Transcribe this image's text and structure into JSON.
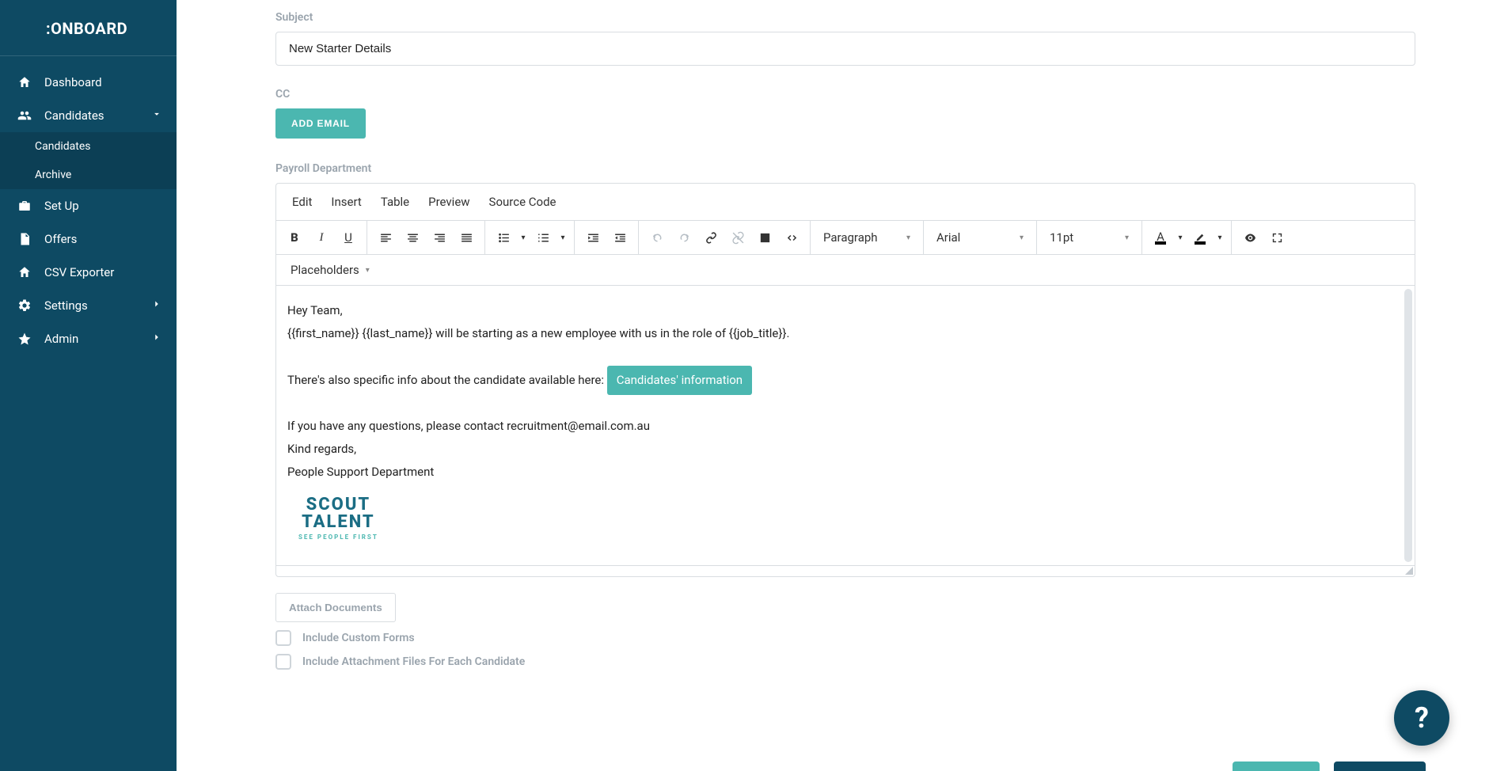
{
  "brand": ":ONBOARD",
  "sidebar": {
    "items": [
      {
        "label": "Dashboard"
      },
      {
        "label": "Candidates"
      },
      {
        "label": "Set Up"
      },
      {
        "label": "Offers"
      },
      {
        "label": "CSV Exporter"
      },
      {
        "label": "Settings"
      },
      {
        "label": "Admin"
      }
    ],
    "candidates_sub": [
      {
        "label": "Candidates"
      },
      {
        "label": "Archive"
      }
    ]
  },
  "labels": {
    "subject": "Subject",
    "cc": "CC",
    "payroll": "Payroll Department",
    "add_email": "ADD EMAIL",
    "attach": "Attach Documents",
    "include_forms": "Include Custom Forms",
    "include_files": "Include Attachment Files For Each Candidate"
  },
  "form": {
    "subject_value": "New Starter Details"
  },
  "editor": {
    "menu": {
      "edit": "Edit",
      "insert": "Insert",
      "table": "Table",
      "preview": "Preview",
      "source": "Source Code"
    },
    "block_format": "Paragraph",
    "font_family": "Arial",
    "font_size": "11pt",
    "placeholders_label": "Placeholders",
    "body": {
      "line1": "Hey Team,",
      "line2": "{{first_name}} {{last_name}} will be starting as a new employee with us in the role of {{job_title}}.",
      "line3_pre": "There's also specific info about the candidate available here: ",
      "cands_btn": "Candidates' information",
      "line4": "If you have any questions, please contact recruitment@email.com.au",
      "line5": "Kind regards,",
      "line6": "People Support Department",
      "logo_line1": "SCOUT",
      "logo_line2": "TALENT",
      "logo_tag": "SEE PEOPLE FIRST"
    }
  },
  "help": "?"
}
